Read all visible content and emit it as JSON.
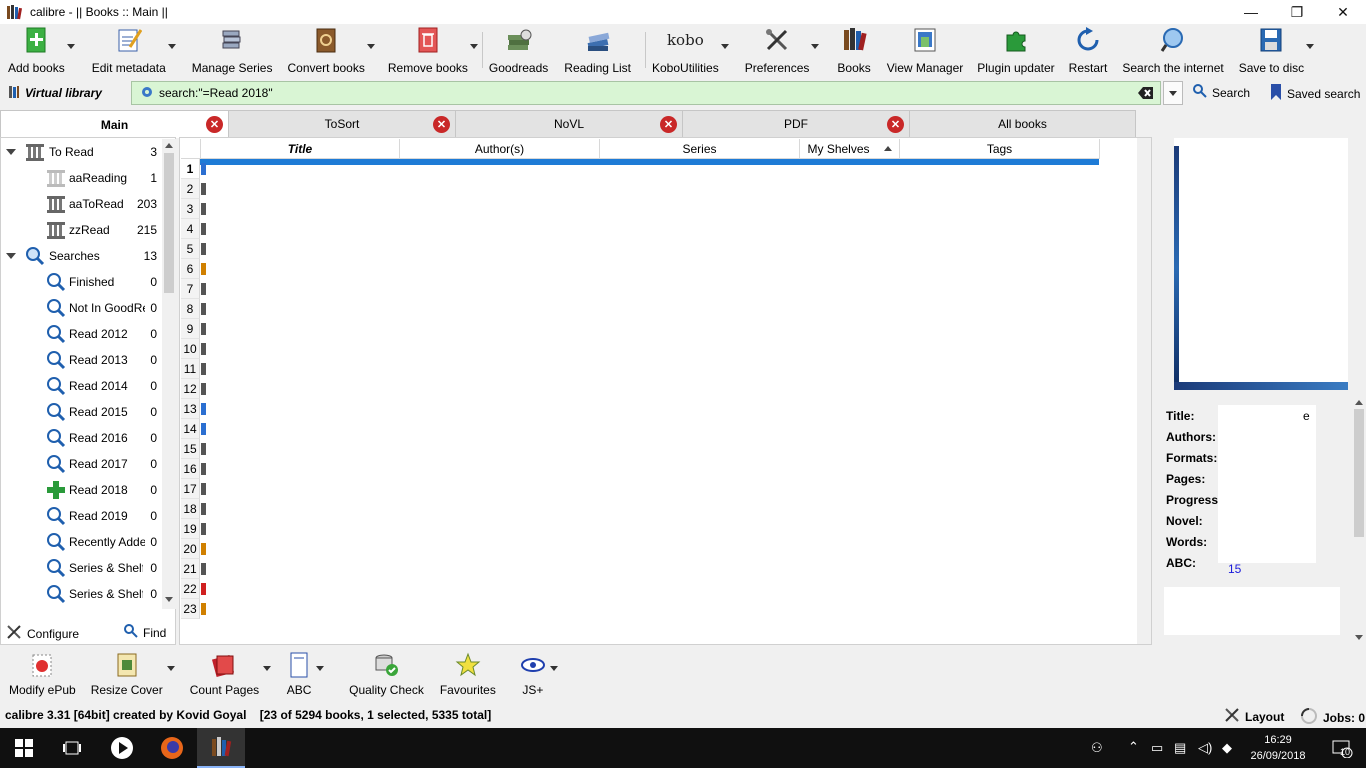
{
  "window": {
    "title": "calibre - || Books :: Main ||",
    "minimize": "—",
    "maximize": "❐",
    "close": "✕"
  },
  "toolbar": {
    "items": [
      {
        "label": "Add books",
        "icon": "add-books-icon"
      },
      {
        "label": "Edit metadata",
        "icon": "edit-metadata-icon"
      },
      {
        "label": "Manage Series",
        "icon": "manage-series-icon"
      },
      {
        "label": "Convert books",
        "icon": "convert-books-icon"
      },
      {
        "label": "Remove books",
        "icon": "remove-books-icon"
      },
      {
        "label": "Goodreads",
        "icon": "goodreads-icon"
      },
      {
        "label": "Reading List",
        "icon": "reading-list-icon"
      },
      {
        "label": "KoboUtilities",
        "icon": "kobo-icon"
      },
      {
        "label": "Preferences",
        "icon": "preferences-icon"
      },
      {
        "label": "Books",
        "icon": "books-icon"
      },
      {
        "label": "View Manager",
        "icon": "view-manager-icon"
      },
      {
        "label": "Plugin updater",
        "icon": "plugin-updater-icon"
      },
      {
        "label": "Restart",
        "icon": "restart-icon"
      },
      {
        "label": "Search the internet",
        "icon": "search-internet-icon"
      },
      {
        "label": "Save to disc",
        "icon": "save-icon"
      }
    ],
    "kobo_logo": "kobo"
  },
  "search": {
    "virtual_library_label": "Virtual library",
    "query": "search:\"=Read 2018\"",
    "search_label": "Search",
    "saved_search_label": "Saved search"
  },
  "tabs": [
    {
      "label": "Main",
      "active": true
    },
    {
      "label": "ToSort"
    },
    {
      "label": "NoVL"
    },
    {
      "label": "PDF"
    },
    {
      "label": "All books"
    }
  ],
  "tag_browser": {
    "items": [
      {
        "label": "To Read",
        "count": "3"
      },
      {
        "label": "aaReading",
        "count": "1"
      },
      {
        "label": "aaToRead",
        "count": "203"
      },
      {
        "label": "zzRead",
        "count": "215"
      },
      {
        "label": "Searches",
        "count": "13"
      },
      {
        "label": "Finished",
        "count": "0"
      },
      {
        "label": "Not In GoodReads",
        "count": "0"
      },
      {
        "label": "Read 2012",
        "count": "0"
      },
      {
        "label": "Read 2013",
        "count": "0"
      },
      {
        "label": "Read 2014",
        "count": "0"
      },
      {
        "label": "Read 2015",
        "count": "0"
      },
      {
        "label": "Read 2016",
        "count": "0"
      },
      {
        "label": "Read 2017",
        "count": "0"
      },
      {
        "label": "Read 2018",
        "count": "0"
      },
      {
        "label": "Read 2019",
        "count": "0"
      },
      {
        "label": "Recently Added",
        "count": "0"
      },
      {
        "label": "Series & Shelf",
        "count": "0"
      },
      {
        "label": "Series & Shelf",
        "count": "0"
      }
    ],
    "configure_label": "Configure",
    "find_label": "Find"
  },
  "book_list": {
    "columns": [
      "Title",
      "Author(s)",
      "Series",
      "My Shelves",
      "Tags"
    ],
    "row_numbers": [
      "1",
      "2",
      "3",
      "4",
      "5",
      "6",
      "7",
      "8",
      "9",
      "10",
      "11",
      "12",
      "13",
      "14",
      "15",
      "16",
      "17",
      "18",
      "19",
      "20",
      "21",
      "22",
      "23"
    ],
    "row_stub_colors": [
      "#2b6fd1",
      "#555",
      "#555",
      "#555",
      "#555",
      "#d08000",
      "#555",
      "#555",
      "#555",
      "#555",
      "#555",
      "#555",
      "#2b6fd1",
      "#2b6fd1",
      "#555",
      "#555",
      "#555",
      "#555",
      "#555",
      "#d08000",
      "#555",
      "#d02020",
      "#d08000"
    ],
    "selection_color": "#1e7bd6"
  },
  "details": {
    "labels": [
      "Title:",
      "Authors:",
      "Formats:",
      "Pages:",
      "Progress",
      "Novel:",
      "Words:",
      "ABC:"
    ],
    "title_tail": "e",
    "abc_value": "15"
  },
  "bottom_toolbar": {
    "items": [
      {
        "label": "Modify ePub",
        "icon": "modify-epub-icon"
      },
      {
        "label": "Resize Cover",
        "icon": "resize-cover-icon"
      },
      {
        "label": "Count Pages",
        "icon": "count-pages-icon"
      },
      {
        "label": "ABC",
        "icon": "abc-icon"
      },
      {
        "label": "Quality Check",
        "icon": "quality-check-icon"
      },
      {
        "label": "Favourites",
        "icon": "favourites-icon"
      },
      {
        "label": "JS+",
        "icon": "js-eye-icon"
      }
    ]
  },
  "status": {
    "text": "calibre 3.31 [64bit] created by Kovid Goyal    [23 of 5294 books, 1 selected, 5335 total]",
    "layout_label": "Layout",
    "jobs_label": "Jobs: 0"
  },
  "taskbar": {
    "time": "16:29",
    "date": "26/09/2018",
    "notifications": "10"
  }
}
